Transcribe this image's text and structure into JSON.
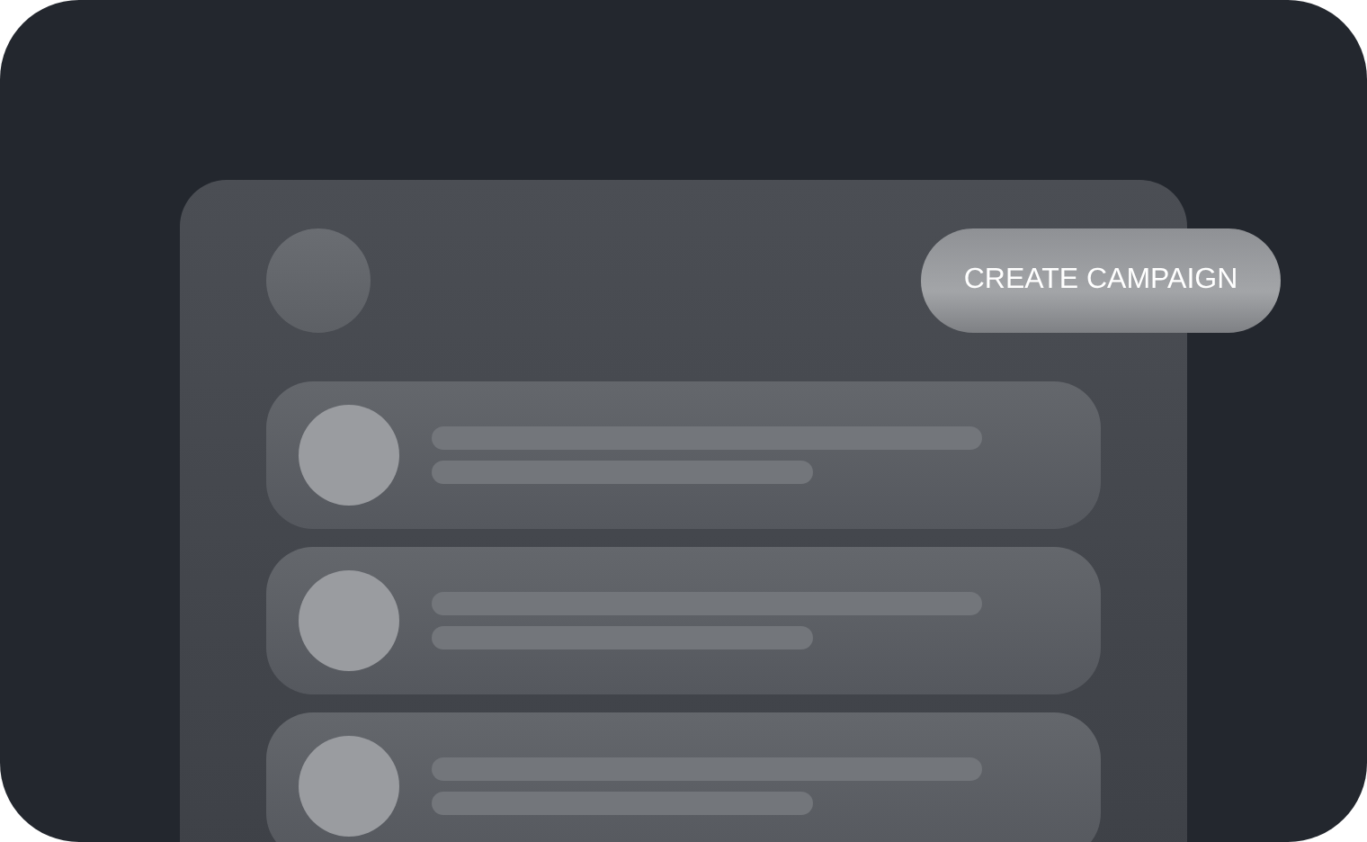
{
  "header": {
    "button": "CREATE CAMPAIGN"
  },
  "rows": [
    {
      "kind": "contact"
    },
    {
      "kind": "contact"
    },
    {
      "kind": "contact"
    }
  ]
}
